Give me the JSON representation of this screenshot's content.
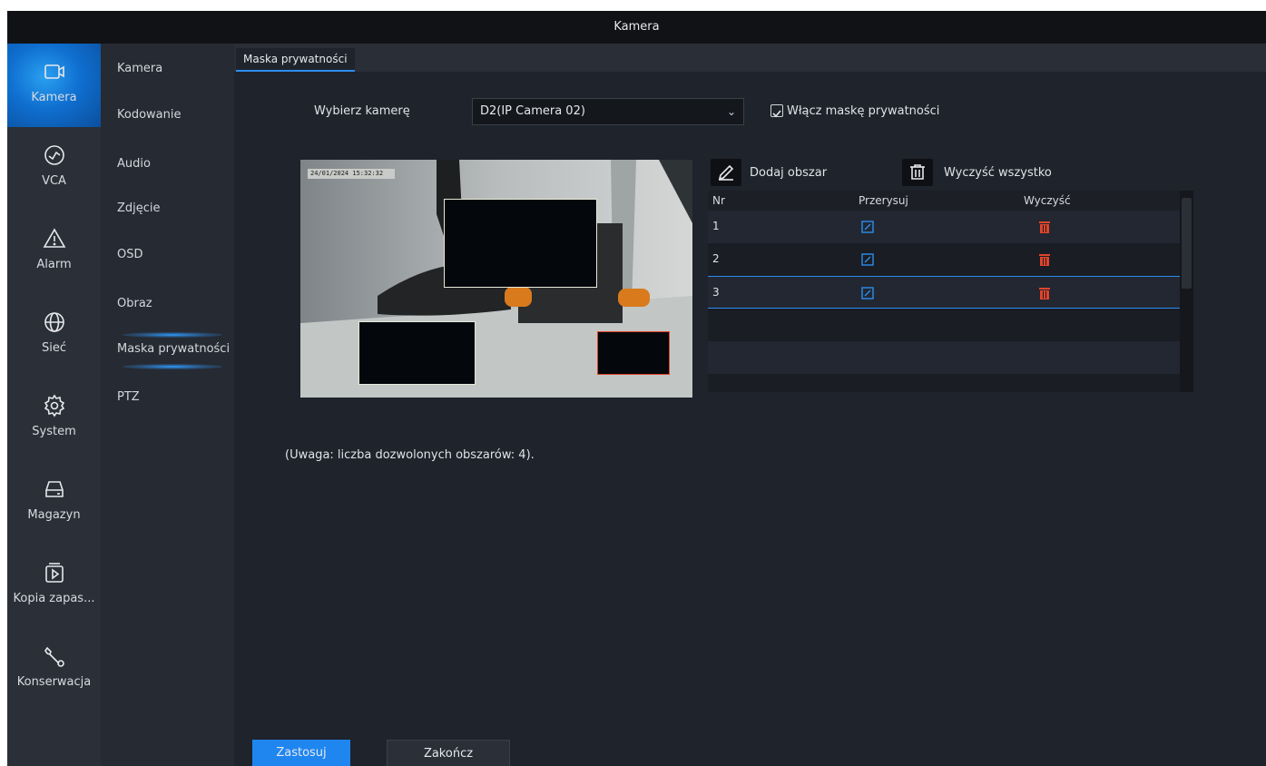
{
  "window": {
    "title": "Kamera"
  },
  "nav": [
    {
      "label": "Kamera",
      "icon": "camera-icon",
      "active": true
    },
    {
      "label": "VCA",
      "icon": "vca-icon"
    },
    {
      "label": "Alarm",
      "icon": "alarm-icon"
    },
    {
      "label": "Sieć",
      "icon": "network-icon"
    },
    {
      "label": "System",
      "icon": "gear-icon"
    },
    {
      "label": "Magazyn",
      "icon": "storage-icon"
    },
    {
      "label": "Kopia zapas...",
      "icon": "backup-icon"
    },
    {
      "label": "Konserwacja",
      "icon": "wrench-icon"
    }
  ],
  "subnav": [
    {
      "label": "Kamera"
    },
    {
      "label": "Kodowanie"
    },
    {
      "label": "Audio"
    },
    {
      "label": "Zdjęcie"
    },
    {
      "label": "OSD"
    },
    {
      "label": "Obraz"
    },
    {
      "label": "Maska prywatności",
      "active": true
    },
    {
      "label": "PTZ"
    }
  ],
  "tab": {
    "label": "Maska prywatności"
  },
  "camera_select": {
    "label": "Wybierz kamerę",
    "value": "D2(IP Camera 02)"
  },
  "enable_mask": {
    "label": "Włącz maskę prywatności",
    "checked": true
  },
  "preview": {
    "timestamp": "24/01/2024 15:32:32"
  },
  "toolbar": {
    "add_label": "Dodaj obszar",
    "clear_label": "Wyczyść wszystko"
  },
  "table": {
    "headers": [
      "Nr",
      "Przerysuj",
      "Wyczyść"
    ],
    "rows": [
      {
        "nr": "1"
      },
      {
        "nr": "2"
      },
      {
        "nr": "3",
        "selected": true
      }
    ]
  },
  "note": "(Uwaga: liczba dozwolonych obszarów: 4).",
  "buttons": {
    "apply": "Zastosuj",
    "exit": "Zakończ"
  },
  "colors": {
    "accent": "#1f86f0",
    "delete": "#e0442c",
    "background": "#1f232b"
  }
}
